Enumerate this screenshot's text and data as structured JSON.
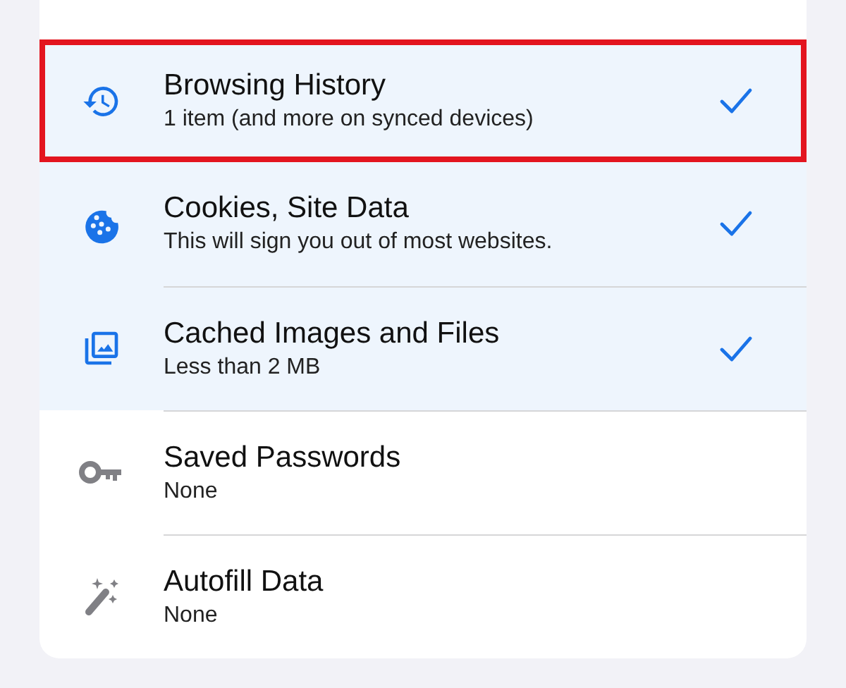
{
  "items": [
    {
      "title": "Browsing History",
      "subtitle": "1 item (and more on synced devices)",
      "selected": true,
      "highlighted": true
    },
    {
      "title": "Cookies, Site Data",
      "subtitle": "This will sign you out of most websites.",
      "selected": true,
      "highlighted": false
    },
    {
      "title": "Cached Images and Files",
      "subtitle": "Less than 2 MB",
      "selected": true,
      "highlighted": false
    },
    {
      "title": "Saved Passwords",
      "subtitle": "None",
      "selected": false,
      "highlighted": false
    },
    {
      "title": "Autofill Data",
      "subtitle": "None",
      "selected": false,
      "highlighted": false
    }
  ]
}
